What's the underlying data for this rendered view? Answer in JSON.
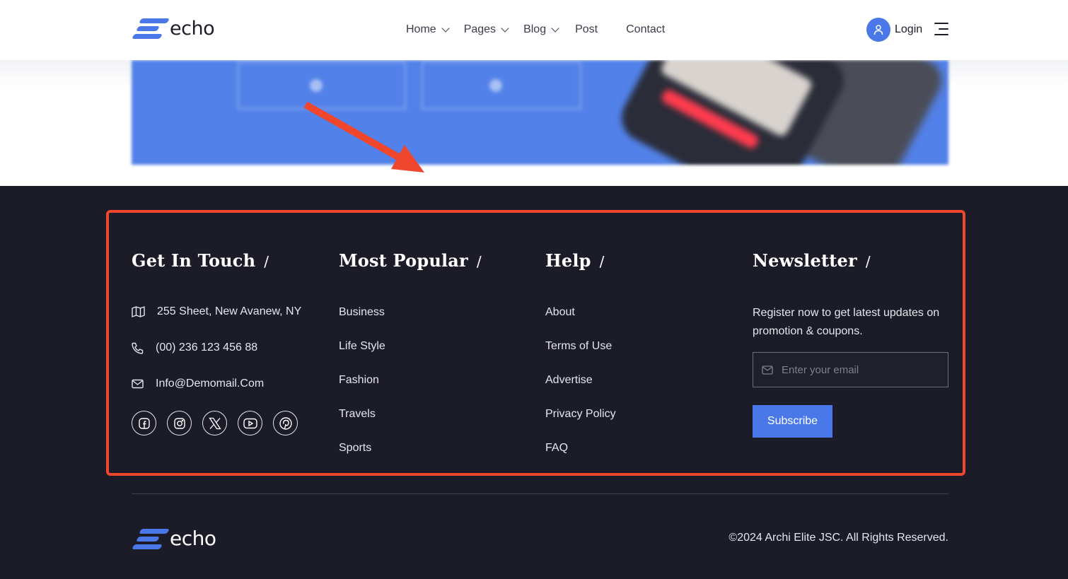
{
  "brand": {
    "name": "echo",
    "accent_color": "#4a78e8"
  },
  "nav": {
    "items": [
      {
        "label": "Home",
        "has_dropdown": true
      },
      {
        "label": "Pages",
        "has_dropdown": true
      },
      {
        "label": "Blog",
        "has_dropdown": true
      },
      {
        "label": "Post",
        "has_dropdown": false
      },
      {
        "label": "Contact",
        "has_dropdown": false
      }
    ],
    "login_label": "Login"
  },
  "annotation": {
    "highlight_color": "#f0462d"
  },
  "footer": {
    "get_in_touch": {
      "title": "Get In Touch",
      "address": "255 Sheet, New Avanew, NY",
      "phone": "(00) 236 123 456 88",
      "email": "Info@Demomail.Com",
      "social_icons": [
        "facebook-icon",
        "instagram-icon",
        "x-icon",
        "youtube-icon",
        "pinterest-icon"
      ]
    },
    "most_popular": {
      "title": "Most Popular",
      "links": [
        "Business",
        "Life Style",
        "Fashion",
        "Travels",
        "Sports"
      ]
    },
    "help": {
      "title": "Help",
      "links": [
        "About",
        "Terms of Use",
        "Advertise",
        "Privacy Policy",
        "FAQ"
      ]
    },
    "newsletter": {
      "title": "Newsletter",
      "text": "Register now to get latest updates on promotion & coupons.",
      "email_placeholder": "Enter your email",
      "subscribe_label": "Subscribe"
    },
    "title_separator": "/",
    "copyright": "©2024 Archi Elite JSC. All Rights Reserved."
  }
}
